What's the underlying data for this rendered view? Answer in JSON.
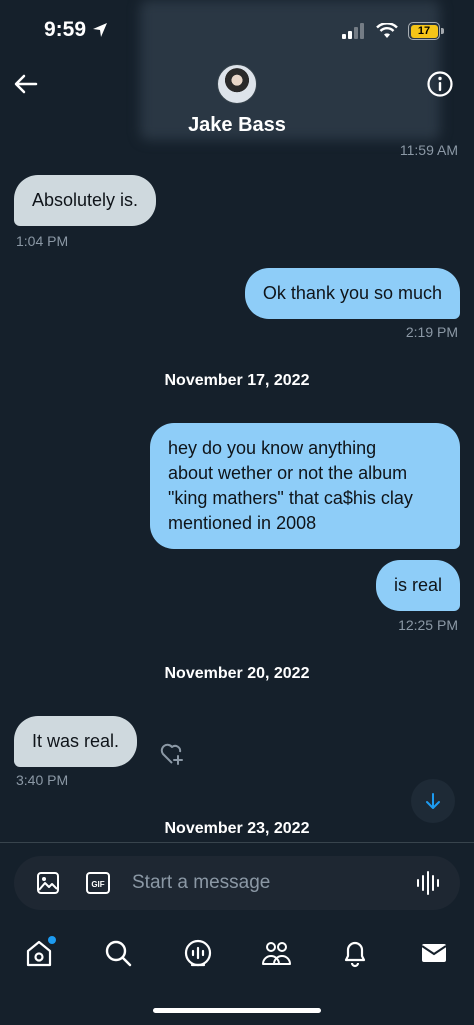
{
  "status_bar": {
    "time": "9:59",
    "battery": "17"
  },
  "header": {
    "contact_name": "Jake Bass",
    "back_icon": "arrow-left-icon",
    "info_icon": "info-icon"
  },
  "messages": [
    {
      "type": "timestamp",
      "text": "11:59 AM"
    },
    {
      "direction": "in",
      "text": "Absolutely is.",
      "time": "1:04 PM"
    },
    {
      "direction": "out",
      "text": "Ok thank you so much",
      "time": "2:19 PM"
    },
    {
      "type": "date",
      "text": "November 17, 2022"
    },
    {
      "direction": "out",
      "lines": [
        "hey do you know anything",
        "about wether or not the album",
        "\"king mathers\" that ca$his clay",
        "mentioned in 2008"
      ]
    },
    {
      "direction": "out",
      "text": "is real",
      "time": "12:25 PM"
    },
    {
      "type": "date",
      "text": "November 20, 2022"
    },
    {
      "direction": "in",
      "text": "It was real.",
      "time": "3:40 PM"
    },
    {
      "type": "date",
      "text": "November 23, 2022"
    }
  ],
  "composer": {
    "placeholder": "Start a message",
    "gif_label": "GIF"
  },
  "tabbar": [
    "home-icon",
    "search-icon",
    "spaces-icon",
    "communities-icon",
    "notifications-icon",
    "messages-icon"
  ]
}
